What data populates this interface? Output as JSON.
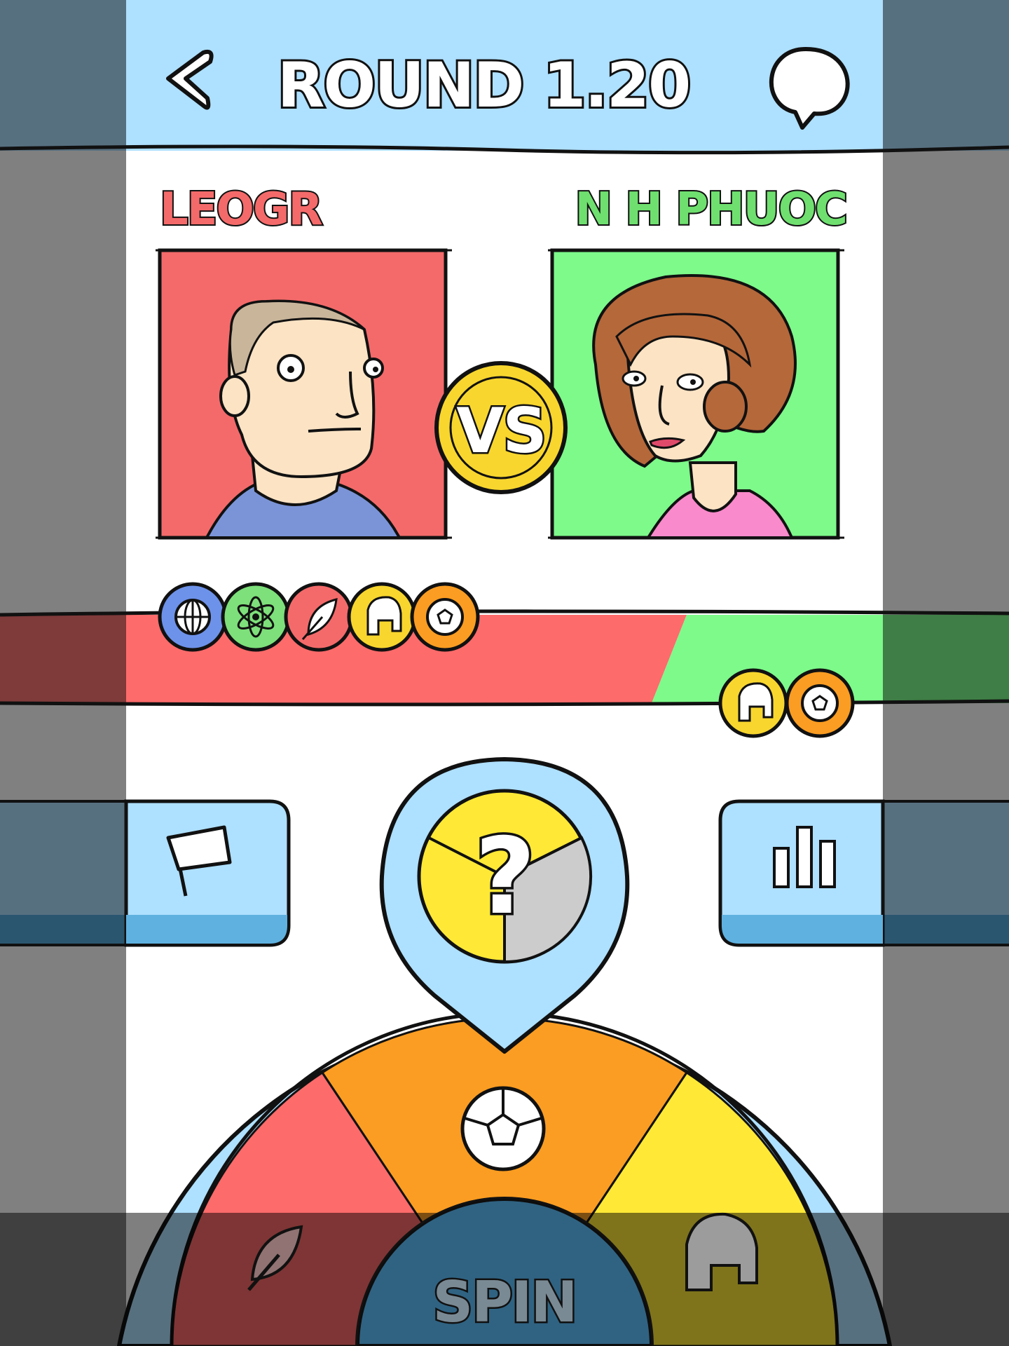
{
  "header": {
    "title": "ROUND 1.20",
    "back_icon": "back-chevron-icon",
    "chat_icon": "chat-bubble-icon"
  },
  "players": {
    "left": {
      "name": "LEOGR",
      "color": "#f46a6a",
      "avatar": "man-avatar"
    },
    "right": {
      "name": "N H PHUOC",
      "color": "#6fe06f",
      "avatar": "woman-avatar"
    }
  },
  "versus": {
    "label": "VS",
    "color": "#f8d62e"
  },
  "trophies": {
    "left": [
      "globe-icon",
      "atom-icon",
      "feather-icon",
      "helmet-icon",
      "soccer-ball-icon"
    ],
    "right": [
      "helmet-icon",
      "soccer-ball-icon"
    ]
  },
  "score_bar": {
    "left_color": "#f46a6a",
    "right_color": "#7dfa8a",
    "left_share": 0.73
  },
  "buttons": {
    "surrender_icon": "flag-icon",
    "stats_icon": "bar-chart-icon"
  },
  "wheel": {
    "pointer_label": "?",
    "segments": [
      "feather-icon",
      "soccer-ball-icon",
      "helmet-icon"
    ],
    "spin_label": "SPIN"
  },
  "colors": {
    "sky": "#aee0ff",
    "blue_btn": "#7fc6ff",
    "red": "#fe6b6b",
    "green": "#7dfa8a",
    "yellow": "#ffe936",
    "orange": "#fb9d22",
    "blue_cat": "#6d92ea",
    "gray": "#cccccc"
  }
}
